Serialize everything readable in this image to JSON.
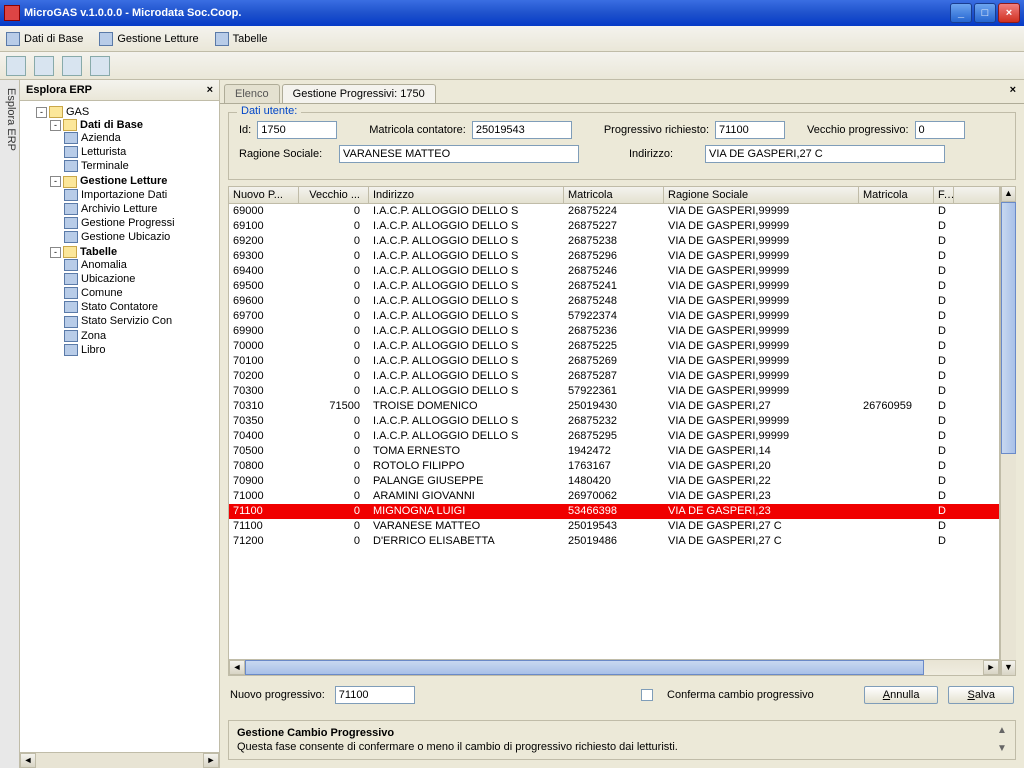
{
  "window": {
    "title": "MicroGAS v.1.0.0.0 - Microdata Soc.Coop."
  },
  "menubar": {
    "m0": "Dati di Base",
    "m1": "Gestione Letture",
    "m2": "Tabelle"
  },
  "sidebar": {
    "title": "Esplora ERP",
    "tab_vert": "Esplora ERP",
    "tree": {
      "root": "GAS",
      "n_dati": "Dati di Base",
      "n_az": "Azienda",
      "n_let": "Letturista",
      "n_term": "Terminale",
      "n_gest": "Gestione Letture",
      "n_imp": "Importazione Dati",
      "n_arch": "Archivio Letture",
      "n_prog": "Gestione Progressi",
      "n_ubic": "Gestione Ubicazio",
      "n_tab": "Tabelle",
      "n_anom": "Anomalia",
      "n_ubi": "Ubicazione",
      "n_com": "Comune",
      "n_stc": "Stato Contatore",
      "n_sts": "Stato Servizio Con",
      "n_zona": "Zona",
      "n_libro": "Libro"
    }
  },
  "tabs": {
    "t0": "Elenco",
    "t1": "Gestione Progressivi: 1750"
  },
  "form": {
    "group": "Dati utente:",
    "l_id": "Id:",
    "v_id": "1750",
    "l_matr": "Matricola contatore:",
    "v_matr": "25019543",
    "l_prog": "Progressivo richiesto:",
    "v_prog": "71100",
    "l_vecchio": "Vecchio progressivo:",
    "v_vecchio": "0",
    "l_rag": "Ragione Sociale:",
    "v_rag": "VARANESE MATTEO",
    "l_ind": "Indirizzo:",
    "v_ind": "VIA DE GASPERI,27 C"
  },
  "grid": {
    "h0": "Nuovo P...",
    "h1": "Vecchio ...",
    "h2": "Indirizzo",
    "h3": "Matricola",
    "h4": "Ragione Sociale",
    "h5": "Matricola",
    "h6": "F...",
    "rows": [
      {
        "c0": "69000",
        "c1": "0",
        "c2": "I.A.C.P. ALLOGGIO DELLO S",
        "c3": "26875224",
        "c4": "VIA DE GASPERI,99999",
        "c5": "",
        "c6": "D"
      },
      {
        "c0": "69100",
        "c1": "0",
        "c2": "I.A.C.P. ALLOGGIO DELLO S",
        "c3": "26875227",
        "c4": "VIA DE GASPERI,99999",
        "c5": "",
        "c6": "D"
      },
      {
        "c0": "69200",
        "c1": "0",
        "c2": "I.A.C.P. ALLOGGIO DELLO S",
        "c3": "26875238",
        "c4": "VIA DE GASPERI,99999",
        "c5": "",
        "c6": "D"
      },
      {
        "c0": "69300",
        "c1": "0",
        "c2": "I.A.C.P. ALLOGGIO DELLO S",
        "c3": "26875296",
        "c4": "VIA DE GASPERI,99999",
        "c5": "",
        "c6": "D"
      },
      {
        "c0": "69400",
        "c1": "0",
        "c2": "I.A.C.P. ALLOGGIO DELLO S",
        "c3": "26875246",
        "c4": "VIA DE GASPERI,99999",
        "c5": "",
        "c6": "D"
      },
      {
        "c0": "69500",
        "c1": "0",
        "c2": "I.A.C.P. ALLOGGIO DELLO S",
        "c3": "26875241",
        "c4": "VIA DE GASPERI,99999",
        "c5": "",
        "c6": "D"
      },
      {
        "c0": "69600",
        "c1": "0",
        "c2": "I.A.C.P. ALLOGGIO DELLO S",
        "c3": "26875248",
        "c4": "VIA DE GASPERI,99999",
        "c5": "",
        "c6": "D"
      },
      {
        "c0": "69700",
        "c1": "0",
        "c2": "I.A.C.P. ALLOGGIO DELLO S",
        "c3": "57922374",
        "c4": "VIA DE GASPERI,99999",
        "c5": "",
        "c6": "D"
      },
      {
        "c0": "69900",
        "c1": "0",
        "c2": "I.A.C.P. ALLOGGIO DELLO S",
        "c3": "26875236",
        "c4": "VIA DE GASPERI,99999",
        "c5": "",
        "c6": "D"
      },
      {
        "c0": "70000",
        "c1": "0",
        "c2": "I.A.C.P. ALLOGGIO DELLO S",
        "c3": "26875225",
        "c4": "VIA DE GASPERI,99999",
        "c5": "",
        "c6": "D"
      },
      {
        "c0": "70100",
        "c1": "0",
        "c2": "I.A.C.P. ALLOGGIO DELLO S",
        "c3": "26875269",
        "c4": "VIA DE GASPERI,99999",
        "c5": "",
        "c6": "D"
      },
      {
        "c0": "70200",
        "c1": "0",
        "c2": "I.A.C.P. ALLOGGIO DELLO S",
        "c3": "26875287",
        "c4": "VIA DE GASPERI,99999",
        "c5": "",
        "c6": "D"
      },
      {
        "c0": "70300",
        "c1": "0",
        "c2": "I.A.C.P. ALLOGGIO DELLO S",
        "c3": "57922361",
        "c4": "VIA DE GASPERI,99999",
        "c5": "",
        "c6": "D"
      },
      {
        "c0": "70310",
        "c1": "71500",
        "c2": "TROISE DOMENICO",
        "c3": "25019430",
        "c4": "VIA DE GASPERI,27",
        "c5": "26760959",
        "c6": "D"
      },
      {
        "c0": "70350",
        "c1": "0",
        "c2": "I.A.C.P. ALLOGGIO DELLO S",
        "c3": "26875232",
        "c4": "VIA DE GASPERI,99999",
        "c5": "",
        "c6": "D"
      },
      {
        "c0": "70400",
        "c1": "0",
        "c2": "I.A.C.P. ALLOGGIO DELLO S",
        "c3": "26875295",
        "c4": "VIA DE GASPERI,99999",
        "c5": "",
        "c6": "D"
      },
      {
        "c0": "70500",
        "c1": "0",
        "c2": "TOMA ERNESTO",
        "c3": "1942472",
        "c4": "VIA DE GASPERI,14",
        "c5": "",
        "c6": "D"
      },
      {
        "c0": "70800",
        "c1": "0",
        "c2": "ROTOLO FILIPPO",
        "c3": "1763167",
        "c4": "VIA DE GASPERI,20",
        "c5": "",
        "c6": "D"
      },
      {
        "c0": "70900",
        "c1": "0",
        "c2": "PALANGE GIUSEPPE",
        "c3": "1480420",
        "c4": "VIA DE GASPERI,22",
        "c5": "",
        "c6": "D"
      },
      {
        "c0": "71000",
        "c1": "0",
        "c2": "ARAMINI GIOVANNI",
        "c3": "26970062",
        "c4": "VIA DE GASPERI,23",
        "c5": "",
        "c6": "D"
      },
      {
        "c0": "71100",
        "c1": "0",
        "c2": "MIGNOGNA LUIGI",
        "c3": "53466398",
        "c4": "VIA DE GASPERI,23",
        "c5": "",
        "c6": "D",
        "sel": true
      },
      {
        "c0": "71100",
        "c1": "0",
        "c2": "VARANESE MATTEO",
        "c3": "25019543",
        "c4": "VIA DE GASPERI,27 C",
        "c5": "",
        "c6": "D"
      },
      {
        "c0": "71200",
        "c1": "0",
        "c2": "D'ERRICO ELISABETTA",
        "c3": "25019486",
        "c4": "VIA DE GASPERI,27 C",
        "c5": "",
        "c6": "D"
      }
    ]
  },
  "bottom": {
    "l_nuovo": "Nuovo progressivo:",
    "v_nuovo": "71100",
    "l_conf": "Conferma cambio progressivo",
    "btn_annulla": "Annulla",
    "btn_salva": "Salva"
  },
  "help": {
    "title": "Gestione Cambio Progressivo",
    "text": "Questa fase consente di confermare o meno il cambio di progressivo richiesto dai letturisti."
  }
}
